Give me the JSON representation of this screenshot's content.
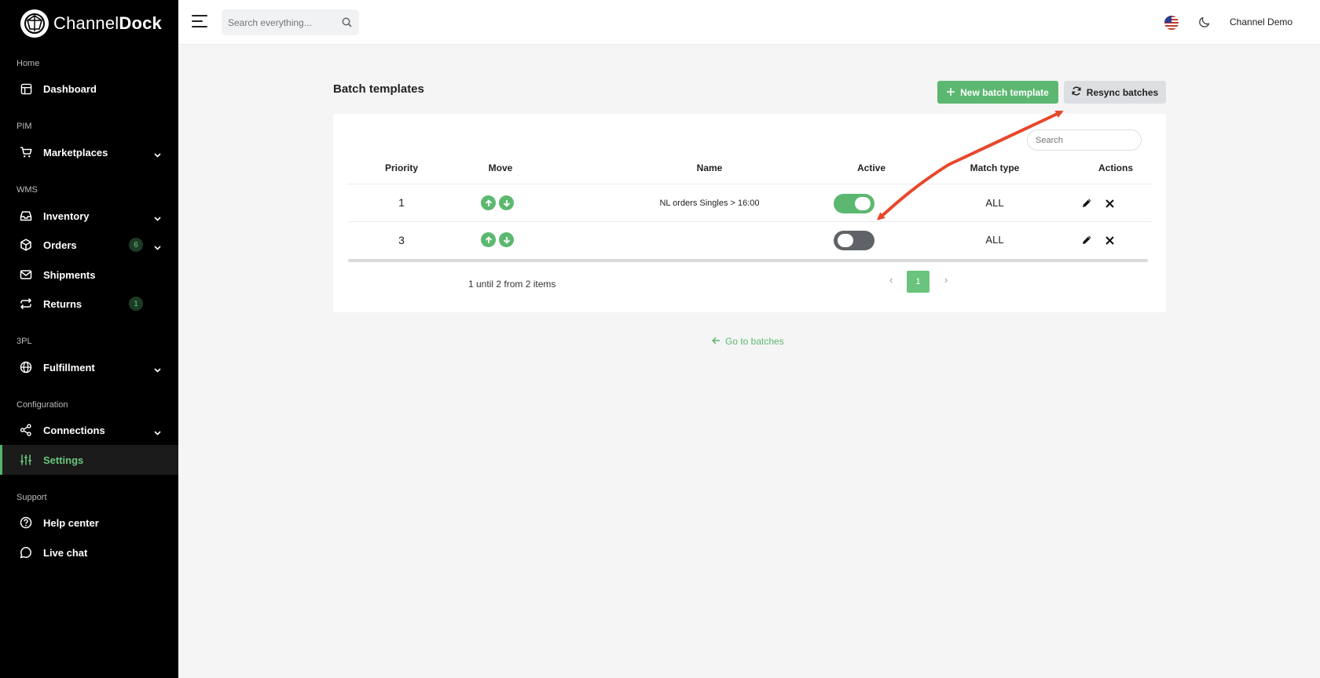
{
  "brand": {
    "prefix": "Channel",
    "bold": "Dock"
  },
  "sidebar": {
    "sections": [
      {
        "label": "Home"
      },
      {
        "label": "PIM"
      },
      {
        "label": "WMS"
      },
      {
        "label": "3PL"
      },
      {
        "label": "Configuration"
      },
      {
        "label": "Support"
      }
    ],
    "items": [
      {
        "label": "Dashboard",
        "icon": "layout-icon"
      },
      {
        "label": "Marketplaces",
        "icon": "cart-icon"
      },
      {
        "label": "Inventory",
        "icon": "inbox-icon"
      },
      {
        "label": "Orders",
        "icon": "box-icon",
        "badge": "6"
      },
      {
        "label": "Shipments",
        "icon": "mail-icon"
      },
      {
        "label": "Returns",
        "icon": "repeat-icon",
        "badge": "1"
      },
      {
        "label": "Fulfillment",
        "icon": "globe-icon"
      },
      {
        "label": "Connections",
        "icon": "share-icon"
      },
      {
        "label": "Settings",
        "icon": "sliders-icon",
        "active": true
      },
      {
        "label": "Help center",
        "icon": "help-icon"
      },
      {
        "label": "Live chat",
        "icon": "chat-icon"
      }
    ]
  },
  "topbar": {
    "search_placeholder": "Search everything...",
    "user_name": "Channel Demo"
  },
  "page": {
    "title": "Batch templates",
    "new_button": "New batch template",
    "resync_button": "Resync batches",
    "search_placeholder": "Search",
    "columns": [
      "Priority",
      "Move",
      "Name",
      "Active",
      "Match type",
      "Actions"
    ],
    "rows": [
      {
        "priority": "1",
        "name": "NL orders Singles > 16:00",
        "active": true,
        "match_type": "ALL"
      },
      {
        "priority": "3",
        "name": "",
        "active": false,
        "match_type": "ALL"
      }
    ],
    "pagination_info": "1 until 2 from 2 items",
    "current_page": "1",
    "back_link": "Go to batches"
  },
  "colors": {
    "accent": "#5cb870",
    "sidebar_bg": "#000000",
    "annotation": "#e8472a"
  }
}
